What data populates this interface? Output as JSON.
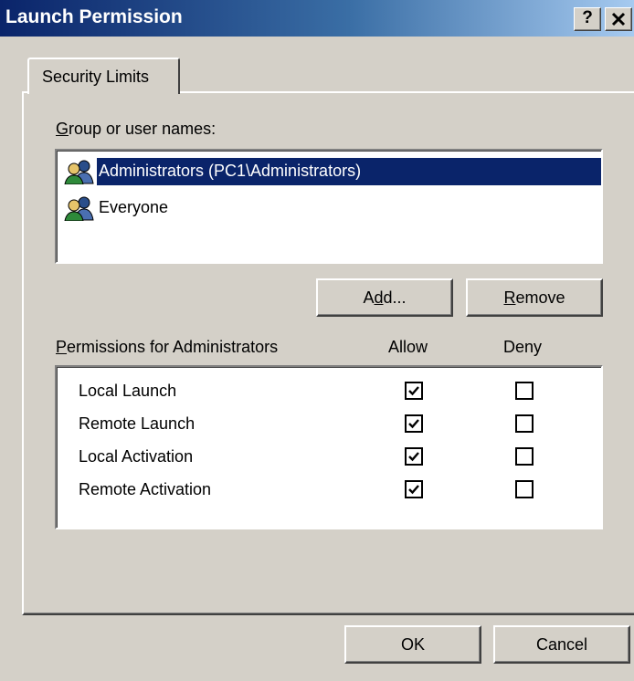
{
  "window": {
    "title": "Launch Permission",
    "help_label": "?",
    "close_label": "X"
  },
  "tab": {
    "label": "Security Limits"
  },
  "groups": {
    "label_prefix_u": "G",
    "label_rest": "roup or user names:",
    "items": [
      {
        "name": "Administrators (PC1\\Administrators)",
        "selected": true,
        "icon": "user-group-icon"
      },
      {
        "name": "Everyone",
        "selected": false,
        "icon": "user-group-icon"
      }
    ],
    "add_button_pre": "A",
    "add_button_u": "d",
    "add_button_post": "d...",
    "remove_button_u": "R",
    "remove_button_post": "emove"
  },
  "permissions": {
    "label_prefix_u": "P",
    "label_rest": "ermissions for Administrators",
    "allow_header": "Allow",
    "deny_header": "Deny",
    "rows": [
      {
        "name": "Local Launch",
        "allow": true,
        "deny": false
      },
      {
        "name": "Remote Launch",
        "allow": true,
        "deny": false
      },
      {
        "name": "Local Activation",
        "allow": true,
        "deny": false
      },
      {
        "name": "Remote Activation",
        "allow": true,
        "deny": false
      }
    ]
  },
  "footer": {
    "ok_label": "OK",
    "cancel_label": "Cancel"
  },
  "colors": {
    "selection": "#0a246a",
    "title_start": "#0a246a",
    "title_end": "#a6caf0",
    "face": "#d4d0c8"
  }
}
